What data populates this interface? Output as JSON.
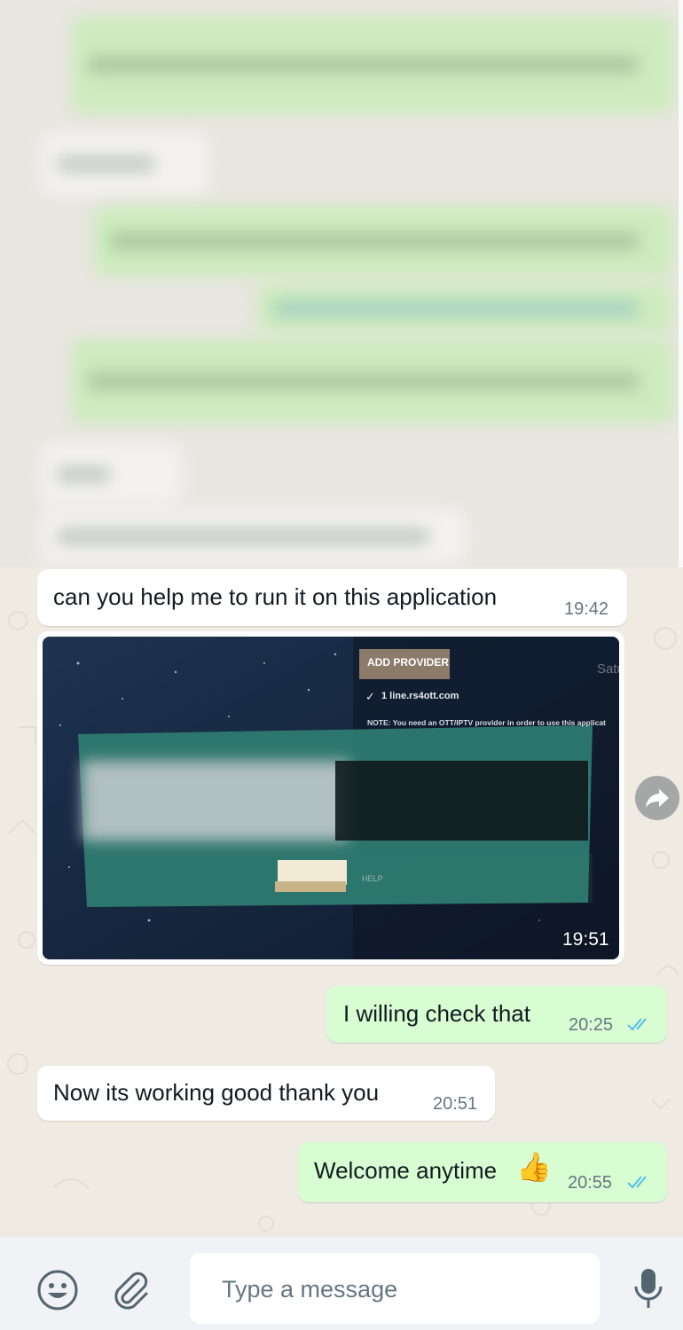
{
  "messages": [
    {
      "id": "m1",
      "direction": "incoming",
      "text": "can you help me to run it on this application",
      "time": "19:42"
    },
    {
      "id": "m2",
      "direction": "incoming",
      "type": "image",
      "time": "19:51",
      "image_text": {
        "button": "ADD PROVIDER",
        "url": "1 line.rs4ott.com",
        "note": "NOTE: You need an OTT/IPTV provider in order to use this applicat",
        "corner": "Satu",
        "help": "HELP"
      }
    },
    {
      "id": "m3",
      "direction": "outgoing",
      "text": "I willing check that",
      "time": "20:25",
      "status": "read"
    },
    {
      "id": "m4",
      "direction": "incoming",
      "text": "Now its working good thank you",
      "time": "20:51"
    },
    {
      "id": "m5",
      "direction": "outgoing",
      "text": "Welcome anytime",
      "emoji": "👍",
      "time": "20:55",
      "status": "read"
    }
  ],
  "input": {
    "placeholder": "Type a message"
  },
  "icons": {
    "emoji": "emoji-icon",
    "attach": "paperclip-icon",
    "mic": "microphone-icon",
    "forward": "forward-icon",
    "ticks": "double-check-icon"
  },
  "colors": {
    "incoming": "#ffffff",
    "outgoing": "#d9fdd3",
    "read_ticks": "#53bdeb",
    "wallpaper": "#efeae2"
  }
}
